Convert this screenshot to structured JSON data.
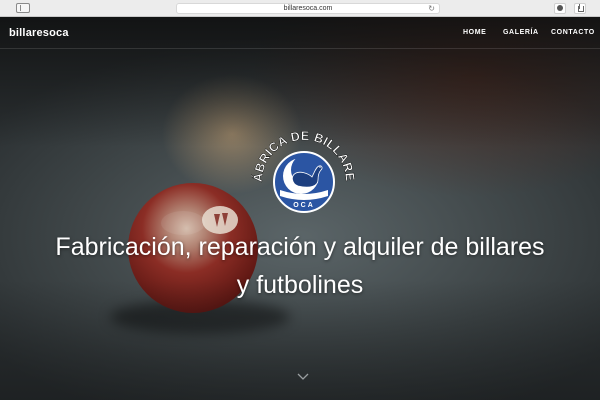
{
  "browser": {
    "url": "billaresoca.com",
    "sidebar_icon": "sidebar-icon",
    "reload_icon": "reload-icon",
    "download_icon": "download-icon",
    "share_icon": "share-icon"
  },
  "navbar": {
    "brand": "billaresoca",
    "links": [
      "HOME",
      "GALERÍA",
      "CONTACTO"
    ]
  },
  "logo": {
    "arc_text": "FÁBRICA DE BILLARES",
    "bottom_text": "OCA",
    "colors": {
      "ring": "#2b55a3",
      "text": "#ffffff"
    }
  },
  "hero": {
    "headline_line1": "Fabricación, reparación y alquiler de billares",
    "headline_line2": "y futbolines",
    "scroll_icon": "chevron-down-icon"
  }
}
